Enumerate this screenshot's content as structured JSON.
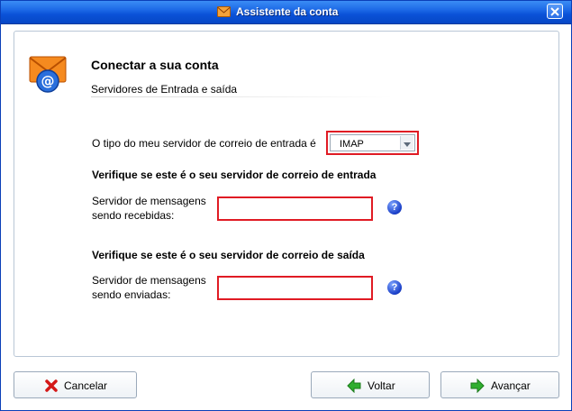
{
  "window": {
    "title": "Assistente da conta"
  },
  "header": {
    "title": "Conectar a sua conta",
    "subtitle": "Servidores de Entrada e saída"
  },
  "form": {
    "server_type_label": "O tipo do meu servidor de correio de entrada é",
    "server_type_value": "IMAP",
    "incoming_heading": "Verifique se este é o seu servidor de correio de entrada",
    "incoming_label_line1": "Servidor de mensagens",
    "incoming_label_line2": "sendo recebidas:",
    "incoming_value": "",
    "outgoing_heading": "Verifique se este é o seu servidor de correio de saída",
    "outgoing_label_line1": "Servidor de mensagens",
    "outgoing_label_line2": "sendo enviadas:",
    "outgoing_value": "",
    "help_glyph": "?"
  },
  "buttons": {
    "cancel": "Cancelar",
    "back": "Voltar",
    "next": "Avançar"
  },
  "icons": {
    "title": "envelope-icon",
    "header": "mail-at-icon",
    "cancel": "red-x-icon",
    "back": "green-left-arrow-icon",
    "next": "green-right-arrow-icon",
    "help": "help-question-icon"
  },
  "colors": {
    "titlebar": "#0a52d8",
    "highlight_border": "#e01b24",
    "help_icon": "#1a3fc8"
  }
}
